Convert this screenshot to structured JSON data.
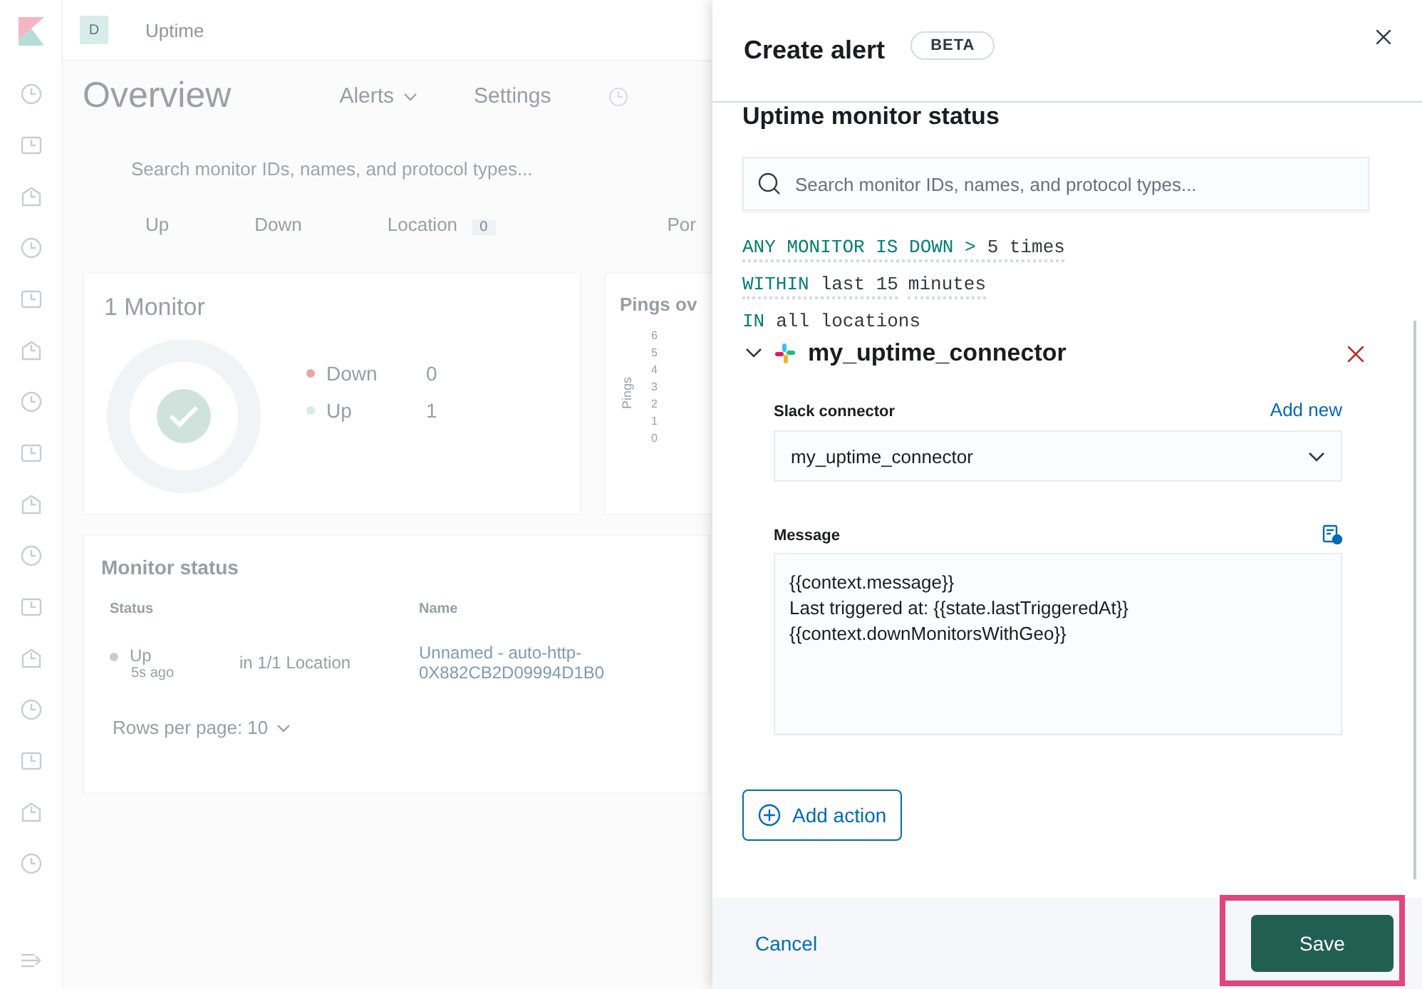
{
  "header": {
    "space_avatar": "D",
    "breadcrumb": "Uptime"
  },
  "page": {
    "title": "Overview",
    "alerts_menu": "Alerts",
    "settings": "Settings",
    "search_placeholder": "Search monitor IDs, names, and protocol types...",
    "filters": [
      {
        "label": "Up"
      },
      {
        "label": "Down"
      },
      {
        "label": "Location",
        "count": "0"
      },
      {
        "label": "Por"
      }
    ]
  },
  "summary": {
    "title": "1 Monitor",
    "legend": [
      {
        "label": "Down",
        "value": "0",
        "color": "#e7a6a0"
      },
      {
        "label": "Up",
        "value": "1",
        "color": "#d6ece4"
      }
    ]
  },
  "pings_chart": {
    "title": "Pings ov",
    "axis_label": "Pings",
    "ticks": [
      "6",
      "5",
      "4",
      "3",
      "2",
      "1",
      "0"
    ]
  },
  "monitor_status": {
    "title": "Monitor status",
    "columns": [
      "Status",
      "Name"
    ],
    "rows": [
      {
        "status": "Up",
        "age": "5s ago",
        "location": "in 1/1 Location",
        "name": "Unnamed - auto-http-0X882CB2D09994D1B0"
      }
    ],
    "pagination": "Rows per page: 10"
  },
  "flyout": {
    "title": "Create alert",
    "badge": "BETA",
    "alert_type": "Uptime monitor status",
    "search_placeholder": "Search monitor IDs, names, and protocol types...",
    "expression_lines": [
      [
        {
          "editable": true,
          "parts": [
            {
              "kind": "keyword",
              "text": "ANY MONITOR IS DOWN >"
            },
            {
              "kind": "value",
              "text": "5 times"
            }
          ]
        }
      ],
      [
        {
          "editable": true,
          "parts": [
            {
              "kind": "keyword",
              "text": "WITHIN"
            },
            {
              "kind": "value",
              "text": "last 15"
            }
          ]
        },
        {
          "editable": true,
          "parts": [
            {
              "kind": "value",
              "text": "minutes"
            }
          ]
        }
      ],
      [
        {
          "editable": false,
          "parts": [
            {
              "kind": "keyword",
              "text": "IN"
            },
            {
              "kind": "value",
              "text": "all locations"
            }
          ]
        }
      ]
    ],
    "action": {
      "name": "my_uptime_connector",
      "expanded": true,
      "connector_label": "Slack connector",
      "add_new": "Add new",
      "connector_value": "my_uptime_connector",
      "message_label": "Message",
      "message": "{{context.message}}\nLast triggered at: {{state.lastTriggeredAt}}\n{{context.downMonitorsWithGeo}}"
    },
    "add_action": "Add action",
    "footer": [
      {
        "kind": "cancel",
        "label": "Cancel",
        "highlighted": false
      },
      {
        "kind": "save",
        "label": "Save",
        "highlighted": true
      }
    ]
  }
}
